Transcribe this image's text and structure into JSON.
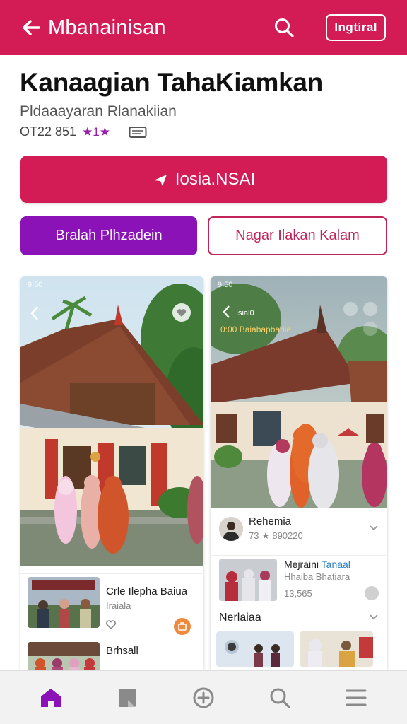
{
  "header": {
    "title": "Mbanainisan",
    "action_label": "Ingtiral"
  },
  "page": {
    "title": "Kanaagian TahaKiamkan",
    "subtitle": "Pldaaayaran Rlanakiian",
    "meta_code": "OT22 851",
    "meta_stars": "★1★"
  },
  "buttons": {
    "primary_label": "Iosia.NSAI",
    "purple_label": "Bralah Plhzadein",
    "outline_label": "Nagar Ilakan Kalam"
  },
  "card_left": {
    "status_left": "9:50",
    "items": [
      {
        "title": "Crle Ilepha Baiua",
        "subtitle": "Iraiala"
      },
      {
        "title": "Brhsall",
        "subtitle": ""
      }
    ]
  },
  "card_right": {
    "status_left": "9:50",
    "overlay_title": "Isial0",
    "overlay_sub": "0:00 Baiabapbariie",
    "profile": {
      "name": "Rehemia",
      "stats": "73 ★ 890220"
    },
    "post": {
      "title": "Mejraini",
      "title_accent": "Tanaal",
      "subtitle": "Hhaiba Bhatiara",
      "count": "13,565"
    },
    "section_title": "Nerlaiaa"
  },
  "colors": {
    "brand": "#d31c56",
    "purple": "#8a12b6",
    "nav_active": "#8a12b6"
  },
  "bottom_nav": {
    "items": [
      "home-icon",
      "bookmark-icon",
      "add-icon",
      "search-icon",
      "menu-icon"
    ],
    "active": "home-icon"
  }
}
